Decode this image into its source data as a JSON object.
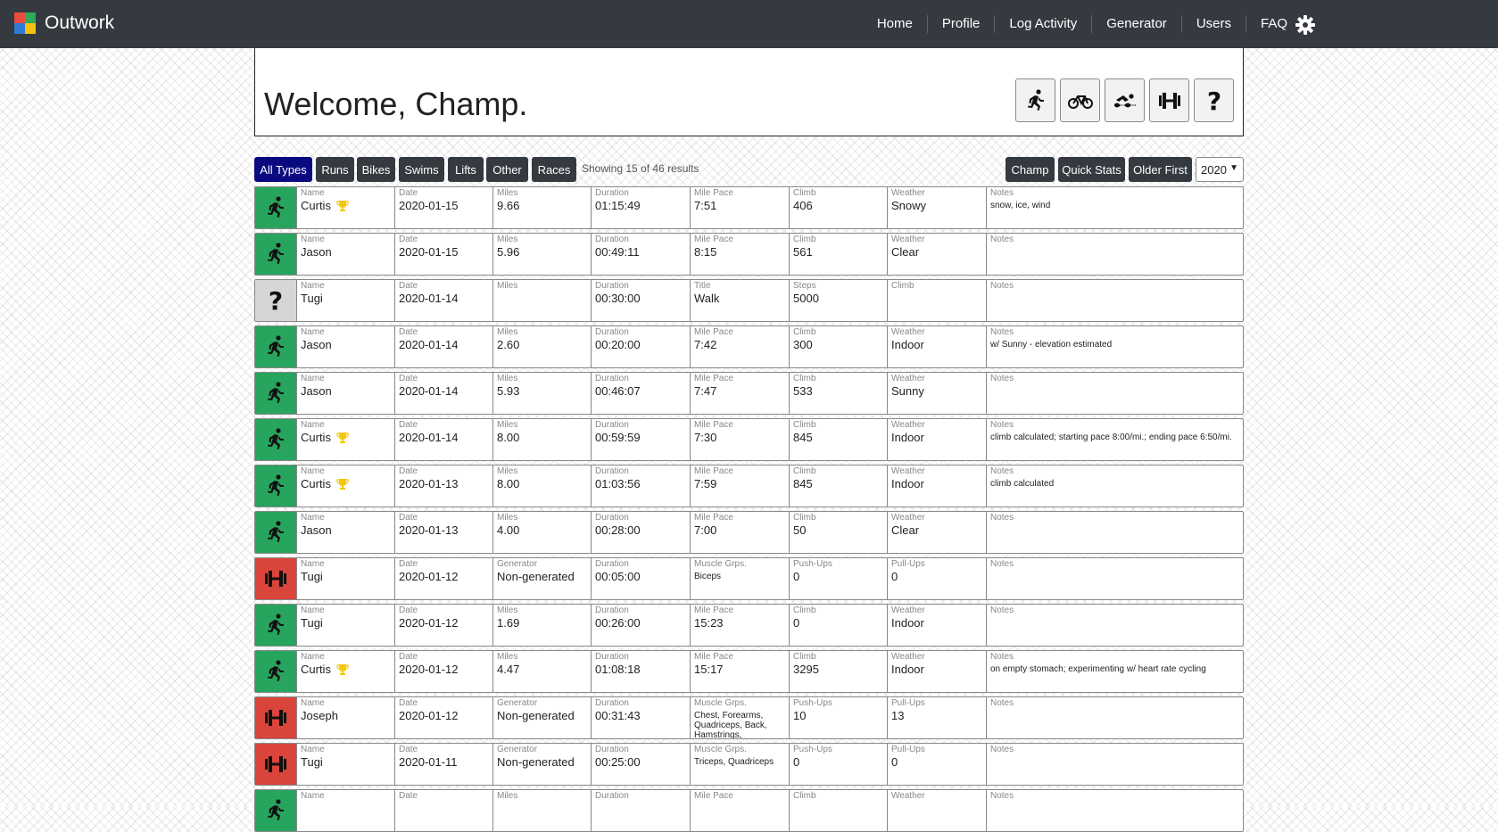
{
  "app": {
    "title": "Outwork",
    "logo_colors": [
      "#e84c3d",
      "#2eaa59",
      "#2f7bd6",
      "#f4c20d"
    ]
  },
  "nav": {
    "items": [
      "Home",
      "Profile",
      "Log Activity",
      "Generator",
      "Users",
      "FAQ"
    ]
  },
  "welcome": {
    "title": "Welcome, Champ."
  },
  "type_buttons": [
    "run-icon",
    "bike-icon",
    "swim-icon",
    "lift-icon",
    "other-icon"
  ],
  "filters": {
    "types": [
      "All Types",
      "Runs",
      "Bikes",
      "Swims",
      "Lifts",
      "Other",
      "Races"
    ],
    "active": "All Types",
    "showing": "Showing 15 of 46 results",
    "actions": [
      "Champ",
      "Quick Stats",
      "Older First"
    ],
    "year": "2020"
  },
  "colors": {
    "run": "#27a55e",
    "lift": "#d9443b",
    "other": "#d6d6d6",
    "trophy": "#f2c80c",
    "navbar": "#343a40",
    "active_filter": "#0a0a80"
  },
  "activities": [
    {
      "type": "run",
      "trophy": true,
      "cells": [
        {
          "label": "Name",
          "value": "Curtis"
        },
        {
          "label": "Date",
          "value": "2020-01-15"
        },
        {
          "label": "Miles",
          "value": "9.66"
        },
        {
          "label": "Duration",
          "value": "01:15:49"
        },
        {
          "label": "Mile Pace",
          "value": "7:51"
        },
        {
          "label": "Climb",
          "value": "406"
        },
        {
          "label": "Weather",
          "value": "Snowy"
        },
        {
          "label": "Notes",
          "value": "snow, ice, wind"
        }
      ]
    },
    {
      "type": "run",
      "trophy": false,
      "cells": [
        {
          "label": "Name",
          "value": "Jason"
        },
        {
          "label": "Date",
          "value": "2020-01-15"
        },
        {
          "label": "Miles",
          "value": "5.96"
        },
        {
          "label": "Duration",
          "value": "00:49:11"
        },
        {
          "label": "Mile Pace",
          "value": "8:15"
        },
        {
          "label": "Climb",
          "value": "561"
        },
        {
          "label": "Weather",
          "value": "Clear"
        },
        {
          "label": "Notes",
          "value": ""
        }
      ]
    },
    {
      "type": "other",
      "trophy": false,
      "cells": [
        {
          "label": "Name",
          "value": "Tugi"
        },
        {
          "label": "Date",
          "value": "2020-01-14"
        },
        {
          "label": "Miles",
          "value": ""
        },
        {
          "label": "Duration",
          "value": "00:30:00"
        },
        {
          "label": "Title",
          "value": "Walk"
        },
        {
          "label": "Steps",
          "value": "5000"
        },
        {
          "label": "Climb",
          "value": ""
        },
        {
          "label": "Notes",
          "value": ""
        }
      ]
    },
    {
      "type": "run",
      "trophy": false,
      "cells": [
        {
          "label": "Name",
          "value": "Jason"
        },
        {
          "label": "Date",
          "value": "2020-01-14"
        },
        {
          "label": "Miles",
          "value": "2.60"
        },
        {
          "label": "Duration",
          "value": "00:20:00"
        },
        {
          "label": "Mile Pace",
          "value": "7:42"
        },
        {
          "label": "Climb",
          "value": "300"
        },
        {
          "label": "Weather",
          "value": "Indoor"
        },
        {
          "label": "Notes",
          "value": "w/ Sunny - elevation estimated"
        }
      ]
    },
    {
      "type": "run",
      "trophy": false,
      "cells": [
        {
          "label": "Name",
          "value": "Jason"
        },
        {
          "label": "Date",
          "value": "2020-01-14"
        },
        {
          "label": "Miles",
          "value": "5.93"
        },
        {
          "label": "Duration",
          "value": "00:46:07"
        },
        {
          "label": "Mile Pace",
          "value": "7:47"
        },
        {
          "label": "Climb",
          "value": "533"
        },
        {
          "label": "Weather",
          "value": "Sunny"
        },
        {
          "label": "Notes",
          "value": ""
        }
      ]
    },
    {
      "type": "run",
      "trophy": true,
      "cells": [
        {
          "label": "Name",
          "value": "Curtis"
        },
        {
          "label": "Date",
          "value": "2020-01-14"
        },
        {
          "label": "Miles",
          "value": "8.00"
        },
        {
          "label": "Duration",
          "value": "00:59:59"
        },
        {
          "label": "Mile Pace",
          "value": "7:30"
        },
        {
          "label": "Climb",
          "value": "845"
        },
        {
          "label": "Weather",
          "value": "Indoor"
        },
        {
          "label": "Notes",
          "value": "climb calculated; starting pace 8:00/mi.; ending pace 6:50/mi."
        }
      ]
    },
    {
      "type": "run",
      "trophy": true,
      "cells": [
        {
          "label": "Name",
          "value": "Curtis"
        },
        {
          "label": "Date",
          "value": "2020-01-13"
        },
        {
          "label": "Miles",
          "value": "8.00"
        },
        {
          "label": "Duration",
          "value": "01:03:56"
        },
        {
          "label": "Mile Pace",
          "value": "7:59"
        },
        {
          "label": "Climb",
          "value": "845"
        },
        {
          "label": "Weather",
          "value": "Indoor"
        },
        {
          "label": "Notes",
          "value": "climb calculated"
        }
      ]
    },
    {
      "type": "run",
      "trophy": false,
      "cells": [
        {
          "label": "Name",
          "value": "Jason"
        },
        {
          "label": "Date",
          "value": "2020-01-13"
        },
        {
          "label": "Miles",
          "value": "4.00"
        },
        {
          "label": "Duration",
          "value": "00:28:00"
        },
        {
          "label": "Mile Pace",
          "value": "7:00"
        },
        {
          "label": "Climb",
          "value": "50"
        },
        {
          "label": "Weather",
          "value": "Clear"
        },
        {
          "label": "Notes",
          "value": ""
        }
      ]
    },
    {
      "type": "lift",
      "trophy": false,
      "cells": [
        {
          "label": "Name",
          "value": "Tugi"
        },
        {
          "label": "Date",
          "value": "2020-01-12"
        },
        {
          "label": "Generator",
          "value": "Non-generated"
        },
        {
          "label": "Duration",
          "value": "00:05:00"
        },
        {
          "label": "Muscle Grps.",
          "value": "Biceps"
        },
        {
          "label": "Push-Ups",
          "value": "0"
        },
        {
          "label": "Pull-Ups",
          "value": "0"
        },
        {
          "label": "Notes",
          "value": ""
        }
      ]
    },
    {
      "type": "run",
      "trophy": false,
      "cells": [
        {
          "label": "Name",
          "value": "Tugi"
        },
        {
          "label": "Date",
          "value": "2020-01-12"
        },
        {
          "label": "Miles",
          "value": "1.69"
        },
        {
          "label": "Duration",
          "value": "00:26:00"
        },
        {
          "label": "Mile Pace",
          "value": "15:23"
        },
        {
          "label": "Climb",
          "value": "0"
        },
        {
          "label": "Weather",
          "value": "Indoor"
        },
        {
          "label": "Notes",
          "value": ""
        }
      ]
    },
    {
      "type": "run",
      "trophy": true,
      "cells": [
        {
          "label": "Name",
          "value": "Curtis"
        },
        {
          "label": "Date",
          "value": "2020-01-12"
        },
        {
          "label": "Miles",
          "value": "4.47"
        },
        {
          "label": "Duration",
          "value": "01:08:18"
        },
        {
          "label": "Mile Pace",
          "value": "15:17"
        },
        {
          "label": "Climb",
          "value": "3295"
        },
        {
          "label": "Weather",
          "value": "Indoor"
        },
        {
          "label": "Notes",
          "value": "on empty stomach; experimenting w/ heart rate cycling"
        }
      ]
    },
    {
      "type": "lift",
      "trophy": false,
      "cells": [
        {
          "label": "Name",
          "value": "Joseph"
        },
        {
          "label": "Date",
          "value": "2020-01-12"
        },
        {
          "label": "Generator",
          "value": "Non-generated"
        },
        {
          "label": "Duration",
          "value": "00:31:43"
        },
        {
          "label": "Muscle Grps.",
          "value": "Chest, Forearms, Quadriceps, Back, Hamstrings,"
        },
        {
          "label": "Push-Ups",
          "value": "10"
        },
        {
          "label": "Pull-Ups",
          "value": "13"
        },
        {
          "label": "Notes",
          "value": ""
        }
      ]
    },
    {
      "type": "lift",
      "trophy": false,
      "cells": [
        {
          "label": "Name",
          "value": "Tugi"
        },
        {
          "label": "Date",
          "value": "2020-01-11"
        },
        {
          "label": "Generator",
          "value": "Non-generated"
        },
        {
          "label": "Duration",
          "value": "00:25:00"
        },
        {
          "label": "Muscle Grps.",
          "value": "Triceps, Quadriceps"
        },
        {
          "label": "Push-Ups",
          "value": "0"
        },
        {
          "label": "Pull-Ups",
          "value": "0"
        },
        {
          "label": "Notes",
          "value": ""
        }
      ]
    },
    {
      "type": "run",
      "trophy": false,
      "cells": [
        {
          "label": "Name",
          "value": ""
        },
        {
          "label": "Date",
          "value": ""
        },
        {
          "label": "Miles",
          "value": ""
        },
        {
          "label": "Duration",
          "value": ""
        },
        {
          "label": "Mile Pace",
          "value": ""
        },
        {
          "label": "Climb",
          "value": ""
        },
        {
          "label": "Weather",
          "value": ""
        },
        {
          "label": "Notes",
          "value": ""
        }
      ]
    }
  ]
}
